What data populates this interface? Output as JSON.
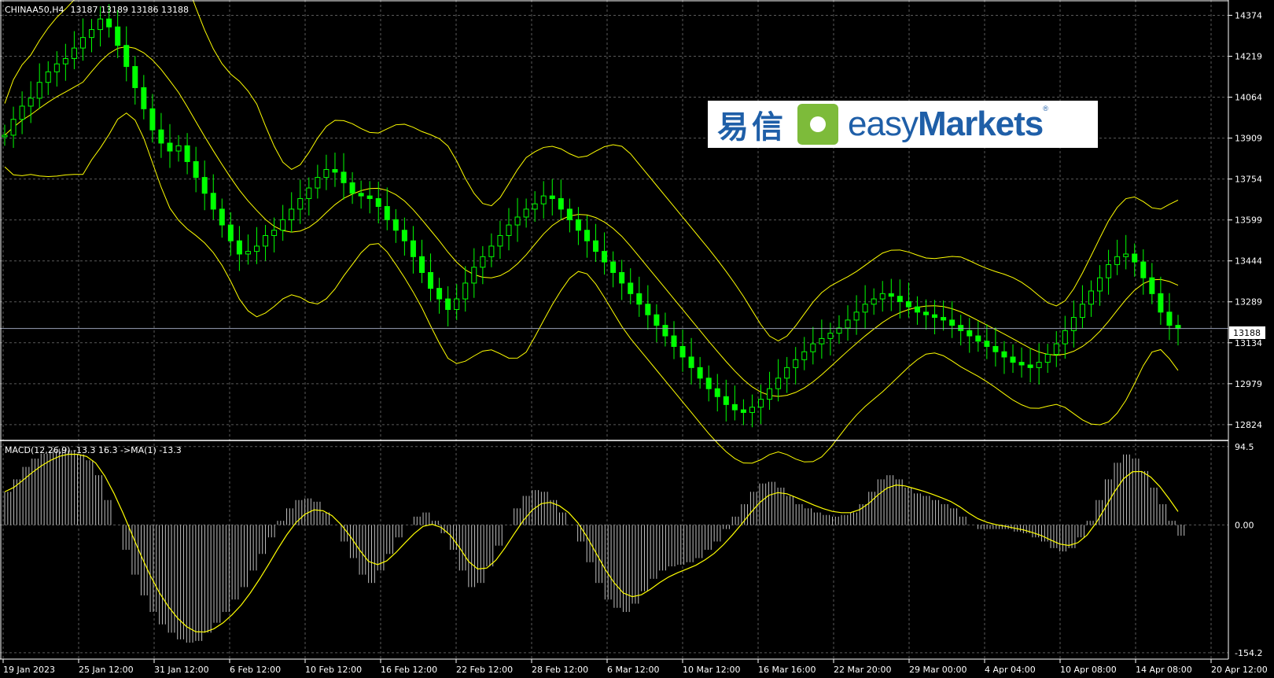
{
  "header": {
    "symbol": "CHINAA50,H4",
    "ohlc": "13187 13189 13186 13188"
  },
  "macd_header": "MACD(12,26,9) -13.3 16.3  ->MA(1) -13.3",
  "logo": {
    "cn": "易信",
    "en_light": "easy",
    "en_bold": "Markets",
    "reg": "®"
  },
  "price_axis": [
    "14374",
    "14219",
    "14064",
    "13909",
    "13754",
    "13599",
    "13444",
    "13289",
    "13134",
    "12979",
    "12824"
  ],
  "current_price": "13188",
  "macd_axis": [
    "94.5",
    "0.00",
    "-154.2"
  ],
  "time_axis": [
    "19 Jan 2023",
    "25 Jan 12:00",
    "31 Jan 12:00",
    "6 Feb 12:00",
    "10 Feb 12:00",
    "16 Feb 12:00",
    "22 Feb 12:00",
    "28 Feb 12:00",
    "6 Mar 12:00",
    "10 Mar 12:00",
    "16 Mar 16:00",
    "22 Mar 20:00",
    "29 Mar 00:00",
    "4 Apr 04:00",
    "10 Apr 08:00",
    "14 Apr 08:00",
    "20 Apr 12:00"
  ],
  "colors": {
    "candle": "#00ff00",
    "bands": "#ffff00",
    "macd_hist": "#c0c0c0",
    "signal": "#ffff00",
    "grid": "#5a5a5a",
    "background": "#000000"
  },
  "chart_data": {
    "type": "line",
    "price_series": [
      13920,
      13980,
      14030,
      14060,
      14120,
      14160,
      14190,
      14210,
      14250,
      14290,
      14320,
      14360,
      14330,
      14260,
      14180,
      14100,
      14020,
      13940,
      13890,
      13860,
      13880,
      13820,
      13760,
      13700,
      13640,
      13580,
      13520,
      13470,
      13480,
      13500,
      13540,
      13560,
      13600,
      13640,
      13680,
      13720,
      13760,
      13790,
      13780,
      13740,
      13700,
      13690,
      13680,
      13650,
      13600,
      13560,
      13520,
      13460,
      13400,
      13340,
      13300,
      13260,
      13300,
      13360,
      13420,
      13460,
      13500,
      13540,
      13580,
      13610,
      13640,
      13660,
      13690,
      13680,
      13640,
      13600,
      13560,
      13520,
      13480,
      13440,
      13400,
      13360,
      13320,
      13280,
      13240,
      13200,
      13160,
      13120,
      13080,
      13040,
      13000,
      12960,
      12930,
      12900,
      12880,
      12870,
      12890,
      12920,
      12960,
      13000,
      13040,
      13070,
      13100,
      13130,
      13150,
      13170,
      13190,
      13220,
      13250,
      13280,
      13300,
      13320,
      13310,
      13290,
      13270,
      13250,
      13240,
      13230,
      13220,
      13200,
      13180,
      13160,
      13140,
      13120,
      13100,
      13080,
      13060,
      13050,
      13040,
      13060,
      13090,
      13130,
      13180,
      13230,
      13280,
      13330,
      13380,
      13430,
      13460,
      13470,
      13440,
      13380,
      13320,
      13250,
      13200,
      13188
    ],
    "macd_series": [
      40,
      55,
      70,
      80,
      86,
      90,
      92,
      90,
      85,
      78,
      60,
      30,
      0,
      -30,
      -60,
      -85,
      -105,
      -120,
      -130,
      -138,
      -142,
      -140,
      -130,
      -118,
      -105,
      -90,
      -75,
      -55,
      -35,
      -15,
      5,
      20,
      30,
      32,
      28,
      15,
      0,
      -20,
      -40,
      -60,
      -70,
      -55,
      -35,
      -15,
      0,
      10,
      15,
      5,
      -10,
      -30,
      -55,
      -75,
      -70,
      -50,
      -25,
      0,
      20,
      35,
      42,
      40,
      30,
      15,
      0,
      -20,
      -45,
      -70,
      -90,
      -100,
      -105,
      -95,
      -80,
      -65,
      -55,
      -50,
      -48,
      -45,
      -40,
      -30,
      -20,
      -5,
      10,
      25,
      40,
      50,
      52,
      45,
      35,
      25,
      20,
      15,
      12,
      10,
      12,
      15,
      25,
      40,
      55,
      60,
      55,
      45,
      38,
      35,
      30,
      25,
      20,
      10,
      0,
      -5,
      -5,
      -5,
      -5,
      -8,
      -10,
      -15,
      -20,
      -28,
      -32,
      -28,
      -15,
      5,
      30,
      55,
      75,
      85,
      80,
      65,
      45,
      25,
      5,
      -13
    ]
  }
}
